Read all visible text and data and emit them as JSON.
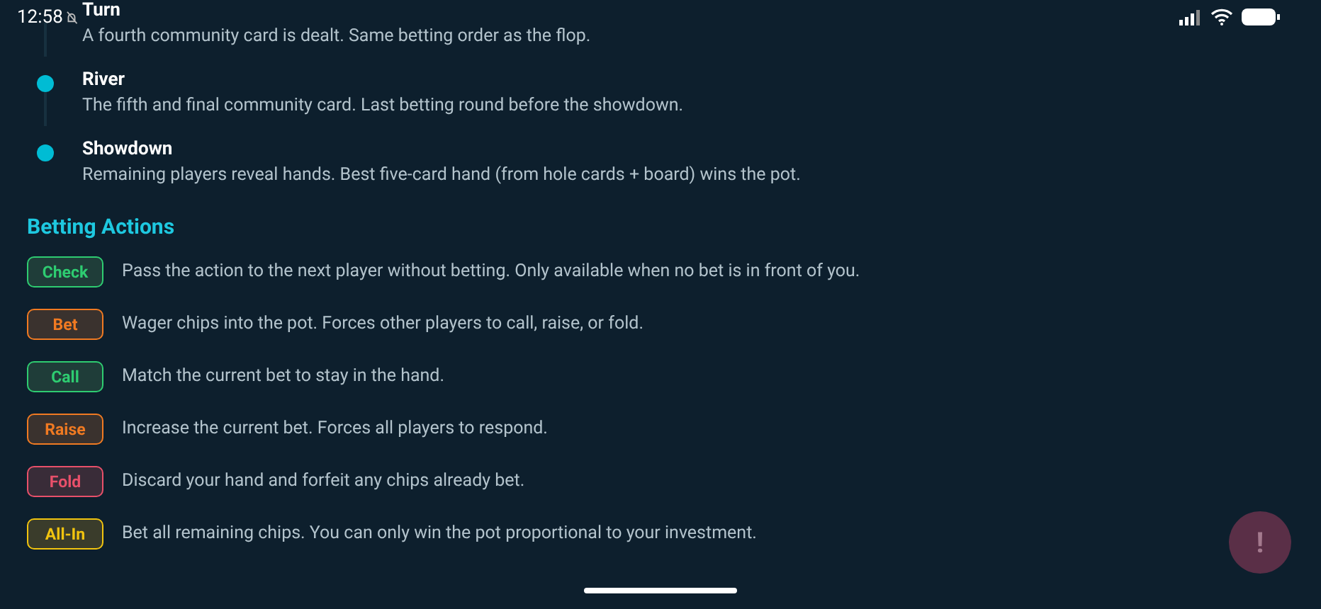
{
  "status_bar": {
    "time": "12:58"
  },
  "phases": [
    {
      "title": "Turn",
      "description": "A fourth community card is dealt. Same betting order as the flop."
    },
    {
      "title": "River",
      "description": "The fifth and final community card. Last betting round before the showdown."
    },
    {
      "title": "Showdown",
      "description": "Remaining players reveal hands. Best five-card hand (from hole cards + board) wins the pot."
    }
  ],
  "betting_actions": {
    "heading": "Betting Actions",
    "items": [
      {
        "label": "Check",
        "color": "#2ecc71",
        "description": "Pass the action to the next player without betting. Only available when no bet is in front of you."
      },
      {
        "label": "Bet",
        "color": "#f07a22",
        "description": "Wager chips into the pot. Forces other players to call, raise, or fold."
      },
      {
        "label": "Call",
        "color": "#2ecc71",
        "description": "Match the current bet to stay in the hand."
      },
      {
        "label": "Raise",
        "color": "#f07a22",
        "description": "Increase the current bet. Forces all players to respond."
      },
      {
        "label": "Fold",
        "color": "#e8506a",
        "description": "Discard your hand and forfeit any chips already bet."
      },
      {
        "label": "All-In",
        "color": "#f1c40f",
        "description": "Bet all remaining chips. You can only win the pot proportional to your investment."
      }
    ]
  },
  "fab": {
    "label": "!"
  }
}
